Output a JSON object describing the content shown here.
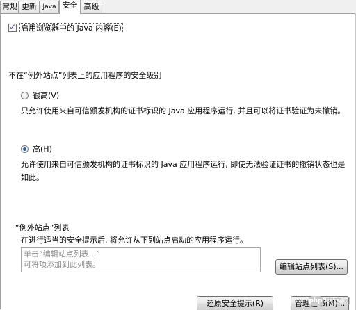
{
  "tabs": [
    {
      "label": "常规"
    },
    {
      "label": "更新"
    },
    {
      "label": "Java"
    },
    {
      "label": "安全"
    },
    {
      "label": "高级"
    }
  ],
  "enable_java_checkbox": {
    "label": "启用浏览器中的 Java 内容(E)",
    "checked": true
  },
  "security_level": {
    "heading": "不在“例外站点”列表上的应用程序的安全级别",
    "very_high": {
      "label": "很高(V)",
      "selected": false,
      "description": "只允许使用来自可信颁发机构的证书标识的 Java 应用程序运行, 并且可以将证书验证为未撤销。"
    },
    "high": {
      "label": "高(H)",
      "selected": true,
      "description": "允许使用来自可信颁发机构的证书标识的 Java 应用程序运行, 即使无法验证证书的撤销状态也是如此。"
    }
  },
  "exception_sites": {
    "heading": "“例外站点”列表",
    "description": "在进行适当的安全提示后, 将允许从下列站点启动的应用程序运行。",
    "list_hint_line1": "单击“编辑站点列表...”",
    "list_hint_line2": "可将项添加到此列表。",
    "edit_button": "编辑站点列表(S)..."
  },
  "bottom_buttons": {
    "restore_prompts": "还原安全提示(R)",
    "manage_certificates": "管理证书(M)..."
  },
  "watermark": {
    "logo": "php",
    "text": "中文网"
  }
}
